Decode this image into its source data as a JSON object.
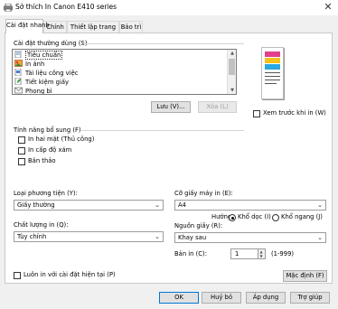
{
  "window": {
    "title": "Sở thích In Canon E410 series",
    "close": "✕"
  },
  "tabs": [
    "Cài đặt nhanh",
    "Chính",
    "Thiết lập trang",
    "Bảo trì"
  ],
  "common_settings": {
    "label": "Cài đặt thường dùng (S)",
    "items": [
      "Tiêu chuẩn",
      "In ảnh",
      "Tài liệu công việc",
      "Tiết kiệm giấy",
      "Phong bì"
    ],
    "save_button": "Lưu (V)...",
    "delete_button": "Xóa (L)",
    "preview_check": "Xem trước khi in (W)"
  },
  "additional_features": {
    "label": "Tính năng bổ sung (F)",
    "options": [
      "In hai mặt (Thủ công)",
      "In cấp độ xám",
      "Bản thảo"
    ]
  },
  "media_type": {
    "label": "Loại phương tiện (Y):",
    "value": "Giấy thường"
  },
  "printer_paper_size": {
    "label": "Cỡ giấy máy in (E):",
    "value": "A4"
  },
  "orientation": {
    "label": "Hướng:",
    "portrait": "Khổ dọc (I)",
    "landscape": "Khổ ngang (J)"
  },
  "print_quality": {
    "label": "Chất lượng in (Q):",
    "value": "Tùy chỉnh"
  },
  "paper_source": {
    "label": "Nguồn giấy (R):",
    "value": "Khay sau"
  },
  "copies": {
    "label": "Bản in (C):",
    "value": "1",
    "range": "(1-999)"
  },
  "always_print": "Luôn in với cài đặt hiện tại (P)",
  "defaults_button": "Mặc định (F)",
  "footer": {
    "ok": "OK",
    "cancel": "Huỷ bỏ",
    "apply": "Áp dụng",
    "help": "Trợ giúp"
  },
  "icons": [
    "printer-icon",
    "close-icon",
    "standard-icon",
    "photo-icon",
    "document-icon",
    "eco-icon",
    "envelope-icon",
    "dropdown-arrow-icon",
    "scroll-up-icon",
    "scroll-down-icon",
    "spin-up-icon",
    "spin-down-icon"
  ]
}
